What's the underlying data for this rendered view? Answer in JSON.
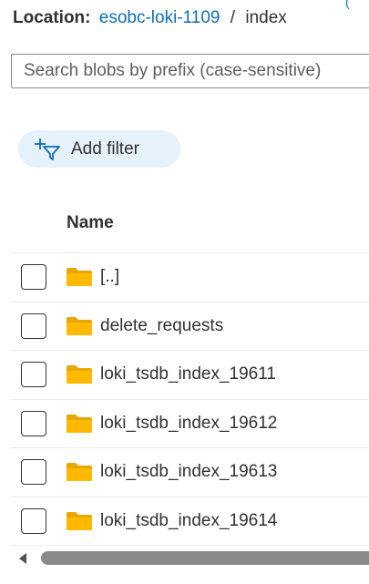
{
  "location": {
    "label": "Location:",
    "container": "esobc-loki-1109",
    "separator": "/",
    "path": "index"
  },
  "search": {
    "placeholder": "Search blobs by prefix (case-sensitive)",
    "value": ""
  },
  "toolbar": {
    "add_filter_label": "Add filter",
    "add_filter_icon": "add-filter-icon"
  },
  "table": {
    "columns": [
      "Name"
    ],
    "rows": [
      {
        "name": "[..]",
        "icon": "folder-icon",
        "checked": false
      },
      {
        "name": "delete_requests",
        "icon": "folder-icon",
        "checked": false
      },
      {
        "name": "loki_tsdb_index_19611",
        "icon": "folder-icon",
        "checked": false
      },
      {
        "name": "loki_tsdb_index_19612",
        "icon": "folder-icon",
        "checked": false
      },
      {
        "name": "loki_tsdb_index_19613",
        "icon": "folder-icon",
        "checked": false
      },
      {
        "name": "loki_tsdb_index_19614",
        "icon": "folder-icon",
        "checked": false
      }
    ]
  },
  "colors": {
    "link": "#0f6cbd",
    "folder": "#ffb900",
    "folder_dark": "#e8a600",
    "filter_pill": "#e5f1fb",
    "filter_icon": "#0f6cbd"
  }
}
